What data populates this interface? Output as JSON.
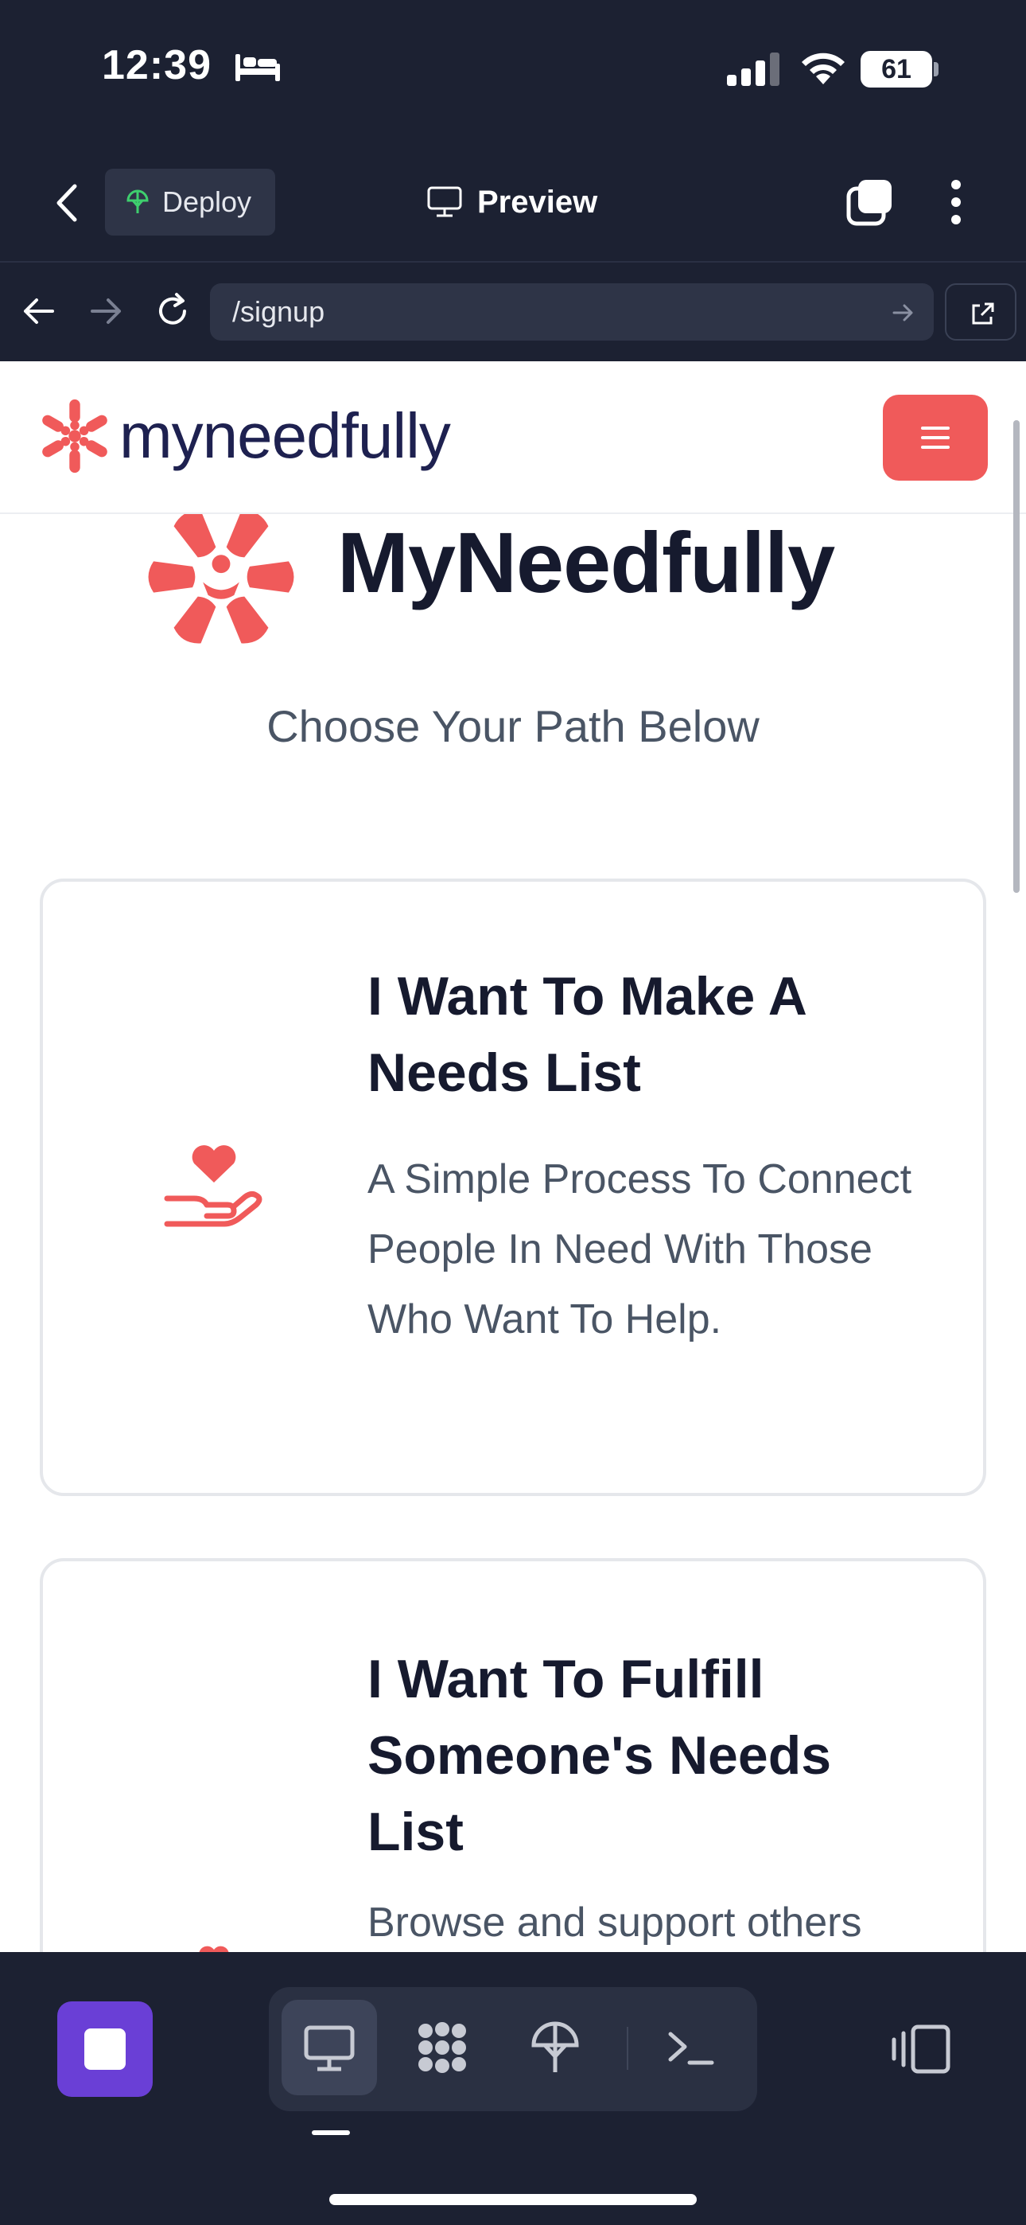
{
  "status_bar": {
    "time": "12:39",
    "battery": "61",
    "icons": [
      "bed-icon",
      "cellular-signal-icon",
      "wifi-icon",
      "battery-icon"
    ]
  },
  "app_header": {
    "deploy_label": "Deploy",
    "preview_label": "Preview",
    "icons": [
      "back-chevron-icon",
      "deploy-globe-icon",
      "monitor-icon",
      "tabs-icon",
      "more-vertical-icon"
    ]
  },
  "browser": {
    "url": "/signup",
    "icons": [
      "back-arrow-icon",
      "forward-arrow-icon",
      "reload-icon",
      "go-arrow-icon",
      "open-external-icon"
    ]
  },
  "site": {
    "brand": "myneedfully",
    "hero_title": "MyNeedfully",
    "subtitle": "Choose Your Path Below",
    "cards": [
      {
        "title": "I Want To Make A Needs List",
        "description": "A Simple Process To Connect People In Need With Those Who Want To Help.",
        "icon": "heart-in-hand-icon"
      },
      {
        "title": "I Want To Fulfill Someone's Needs List",
        "description": "Browse and support others",
        "icon": "hands-holding-heart-icon"
      }
    ]
  },
  "colors": {
    "accent": "#f05a5a",
    "brand_text": "#1e2150",
    "dark_ui": "#1c2132",
    "stop_button": "#6a3fd6"
  },
  "bottom_toolbar": {
    "icons": [
      "stop-icon",
      "monitor-icon",
      "workspace-grid-icon",
      "deploy-globe-icon",
      "terminal-icon",
      "device-frame-icon"
    ],
    "active_tool": "monitor-icon"
  }
}
